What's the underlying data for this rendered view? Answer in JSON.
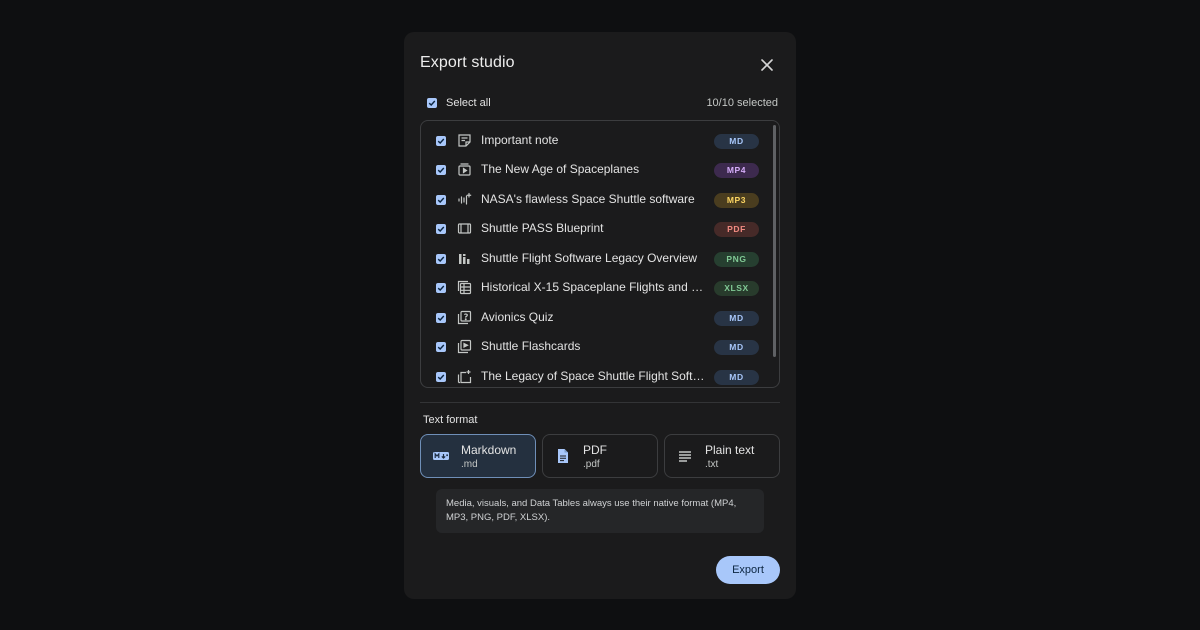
{
  "dialog": {
    "title": "Export studio",
    "select_all_label": "Select all",
    "selected_count": "10/10 selected"
  },
  "items": [
    {
      "name": "Important note",
      "badge": "MD",
      "icon": "note-icon",
      "badge_bg": "#283445",
      "badge_fg": "#a8c7fa"
    },
    {
      "name": "The New Age of Spaceplanes",
      "badge": "MP4",
      "icon": "video-overview-icon",
      "badge_bg": "#3d2a4e",
      "badge_fg": "#d7aefb"
    },
    {
      "name": "NASA's flawless Space Shuttle software",
      "badge": "MP3",
      "icon": "audio-overview-icon",
      "badge_bg": "#4a3d1f",
      "badge_fg": "#fdd663"
    },
    {
      "name": "Shuttle PASS Blueprint",
      "badge": "PDF",
      "icon": "slides-icon",
      "badge_bg": "#462a28",
      "badge_fg": "#f28b82"
    },
    {
      "name": "Shuttle Flight Software Legacy Overview",
      "badge": "PNG",
      "icon": "infographic-icon",
      "badge_bg": "#263f30",
      "badge_fg": "#81c995"
    },
    {
      "name": "Historical X-15 Spaceplane Flights and Pil…",
      "badge": "XLSX",
      "icon": "data-table-icon",
      "badge_bg": "#283b2c",
      "badge_fg": "#81c995"
    },
    {
      "name": "Avionics Quiz",
      "badge": "MD",
      "icon": "quiz-icon",
      "badge_bg": "#283445",
      "badge_fg": "#a8c7fa"
    },
    {
      "name": "Shuttle Flashcards",
      "badge": "MD",
      "icon": "flashcards-icon",
      "badge_bg": "#283445",
      "badge_fg": "#a8c7fa"
    },
    {
      "name": "The Legacy of Space Shuttle Flight Softw…",
      "badge": "MD",
      "icon": "report-icon",
      "badge_bg": "#283445",
      "badge_fg": "#a8c7fa"
    }
  ],
  "text_format": {
    "label": "Text format",
    "options": [
      {
        "name": "Markdown",
        "ext": ".md",
        "icon": "markdown-icon",
        "selected": true
      },
      {
        "name": "PDF",
        "ext": ".pdf",
        "icon": "document-icon",
        "selected": false
      },
      {
        "name": "Plain text",
        "ext": ".txt",
        "icon": "text-lines-icon",
        "selected": false
      }
    ]
  },
  "note": "Media, visuals, and Data Tables always use their native format (MP4, MP3, PNG, PDF, XLSX).",
  "export_label": "Export",
  "colors": {
    "accent": "#a8c7fa",
    "dialog_bg": "#1b1b1c",
    "page_bg": "#0e0f11"
  }
}
